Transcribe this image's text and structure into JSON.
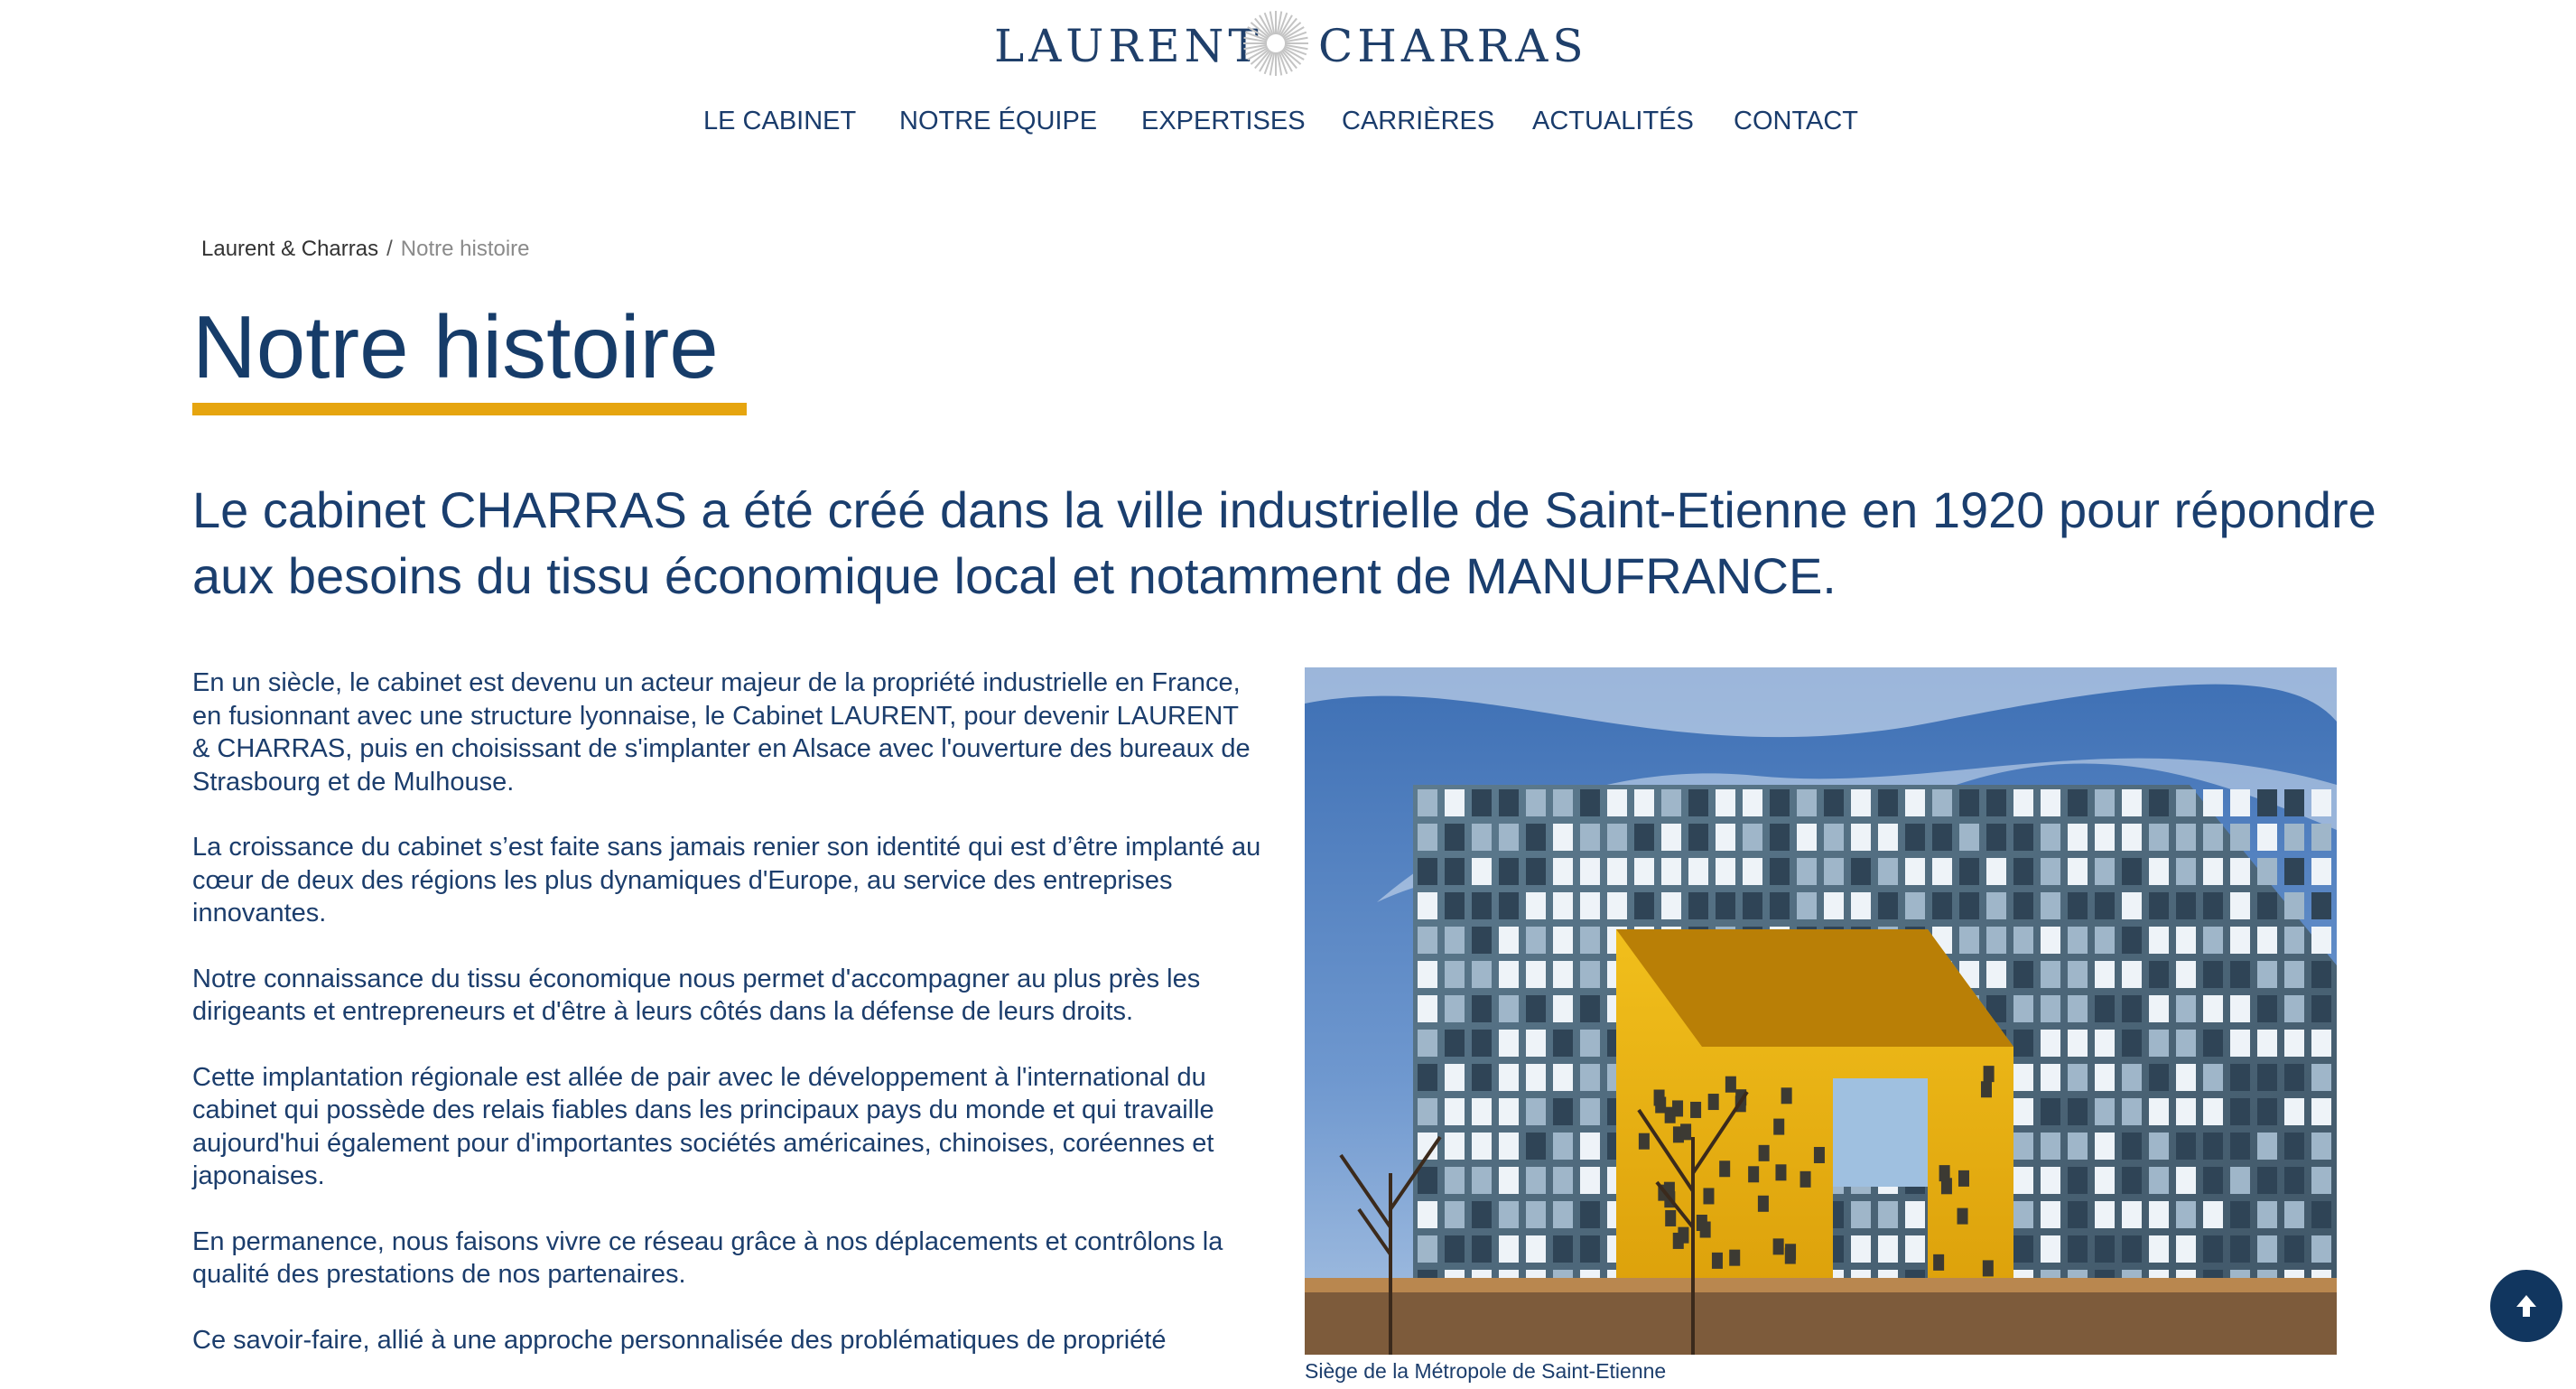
{
  "brand": {
    "name_left": "LAURENT",
    "name_right": "CHARRAS",
    "accent": "#e6a50f",
    "primary": "#163c69"
  },
  "nav": {
    "items": [
      {
        "label": "LE CABINET"
      },
      {
        "label": "NOTRE ÉQUIPE"
      },
      {
        "label": "EXPERTISES"
      },
      {
        "label": "CARRIÈRES"
      },
      {
        "label": "ACTUALITÉS"
      },
      {
        "label": "CONTACT"
      }
    ]
  },
  "breadcrumb": {
    "home": "Laurent & Charras",
    "separator": "/",
    "current": "Notre histoire"
  },
  "page": {
    "title": "Notre histoire",
    "lead": "Le cabinet CHARRAS a été créé dans la ville industrielle de Saint-Etienne en 1920 pour répondre aux besoins du tissu économique local et notamment de MANUFRANCE.",
    "paragraphs": [
      "En un siècle, le cabinet est devenu un acteur majeur de la propriété industrielle en France, en fusionnant avec une structure lyonnaise, le Cabinet LAURENT, pour devenir LAURENT & CHARRAS, puis en choisissant de s'implanter en Alsace avec l'ouverture des bureaux de Strasbourg et de Mulhouse.",
      "La croissance du cabinet s’est faite sans jamais renier son identité qui est d’être implanté au cœur de deux des régions les plus dynamiques d'Europe, au service des entreprises innovantes.",
      "Notre connaissance du tissu économique nous permet d'accompagner au plus près les dirigeants et entrepreneurs et d'être à leurs côtés dans la défense de leurs droits.",
      "Cette implantation régionale est allée de pair avec le développement à l'international du cabinet qui possède des relais fiables dans les principaux pays du monde et qui travaille aujourd'hui également pour d'importantes sociétés américaines, chinoises, coréennes et japonaises.",
      "En permanence, nous faisons vivre ce réseau grâce à nos déplacements et contrôlons la qualité des prestations de nos partenaires.",
      "Ce savoir-faire, allié à une approche personnalisée des problématiques de propriété"
    ],
    "photo_caption": "Siège de la Métropole de Saint-Etienne"
  },
  "icons": {
    "burst": "sunburst-logo-icon",
    "back_to_top": "arrow-up-icon"
  }
}
